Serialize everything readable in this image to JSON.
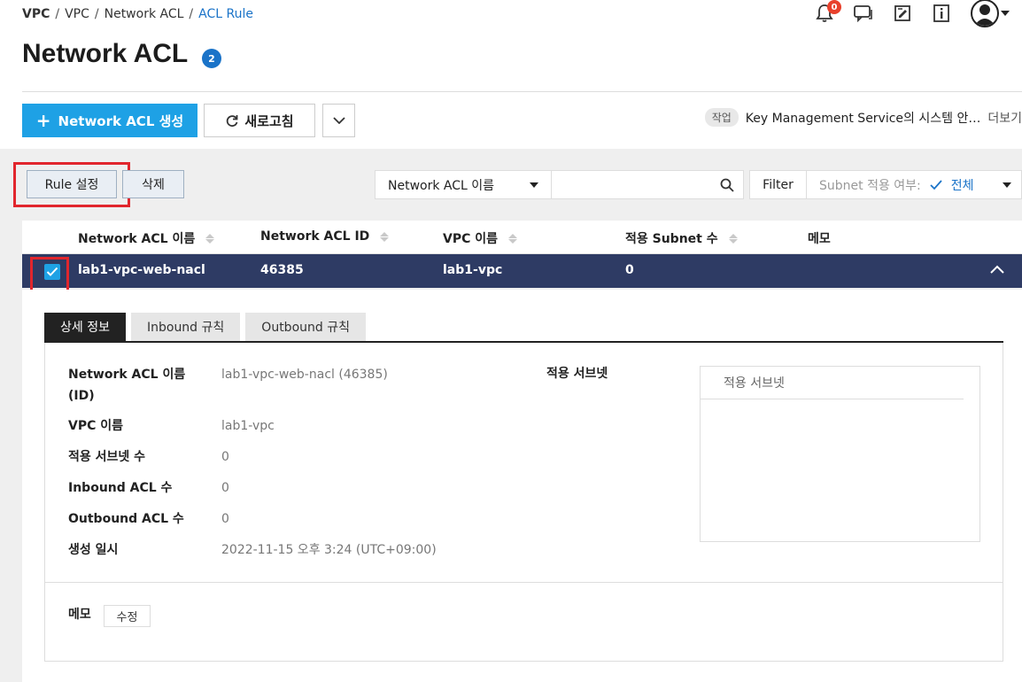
{
  "breadcrumb": [
    "VPC",
    "VPC",
    "Network ACL",
    "ACL Rule"
  ],
  "header": {
    "notification_count": "0",
    "title": "Network ACL",
    "title_count": "2"
  },
  "toolbar": {
    "create_label": "Network ACL 생성",
    "refresh_label": "새로고침",
    "task_tag": "작업",
    "task_text": "Key Management Service의 시스템 안…",
    "task_more": "더보기"
  },
  "actions": {
    "rule_label": "Rule 설정",
    "delete_label": "삭제"
  },
  "search": {
    "select_value": "Network ACL 이름",
    "filter_label": "Filter",
    "filter_key": "Subnet 적용 여부:",
    "filter_value": "전체"
  },
  "table": {
    "columns": [
      "Network ACL 이름",
      "Network ACL ID",
      "VPC 이름",
      "적용 Subnet 수",
      "메모"
    ],
    "row": {
      "name": "lab1-vpc-web-nacl",
      "id": "46385",
      "vpc": "lab1-vpc",
      "subnet_count": "0",
      "memo": ""
    }
  },
  "detail": {
    "tabs": [
      "상세 정보",
      "Inbound 규칙",
      "Outbound 규칙"
    ],
    "fields": [
      {
        "key": "Network ACL 이름 (ID)",
        "value": "lab1-vpc-web-nacl (46385)"
      },
      {
        "key": "VPC 이름",
        "value": "lab1-vpc"
      },
      {
        "key": "적용 서브넷 수",
        "value": "0"
      },
      {
        "key": "Inbound ACL 수",
        "value": "0"
      },
      {
        "key": "Outbound ACL 수",
        "value": "0"
      },
      {
        "key": "생성 일시",
        "value": "2022-11-15 오후 3:24 (UTC+09:00)"
      }
    ],
    "subnet_label": "적용 서브넷",
    "subnet_table_header": "적용 서브넷",
    "memo_label": "메모",
    "memo_edit": "수정"
  },
  "colors": {
    "accent": "#1ea1e5",
    "selected_row": "#2e3b64",
    "highlight": "#e1262d",
    "link": "#1a73c8"
  }
}
